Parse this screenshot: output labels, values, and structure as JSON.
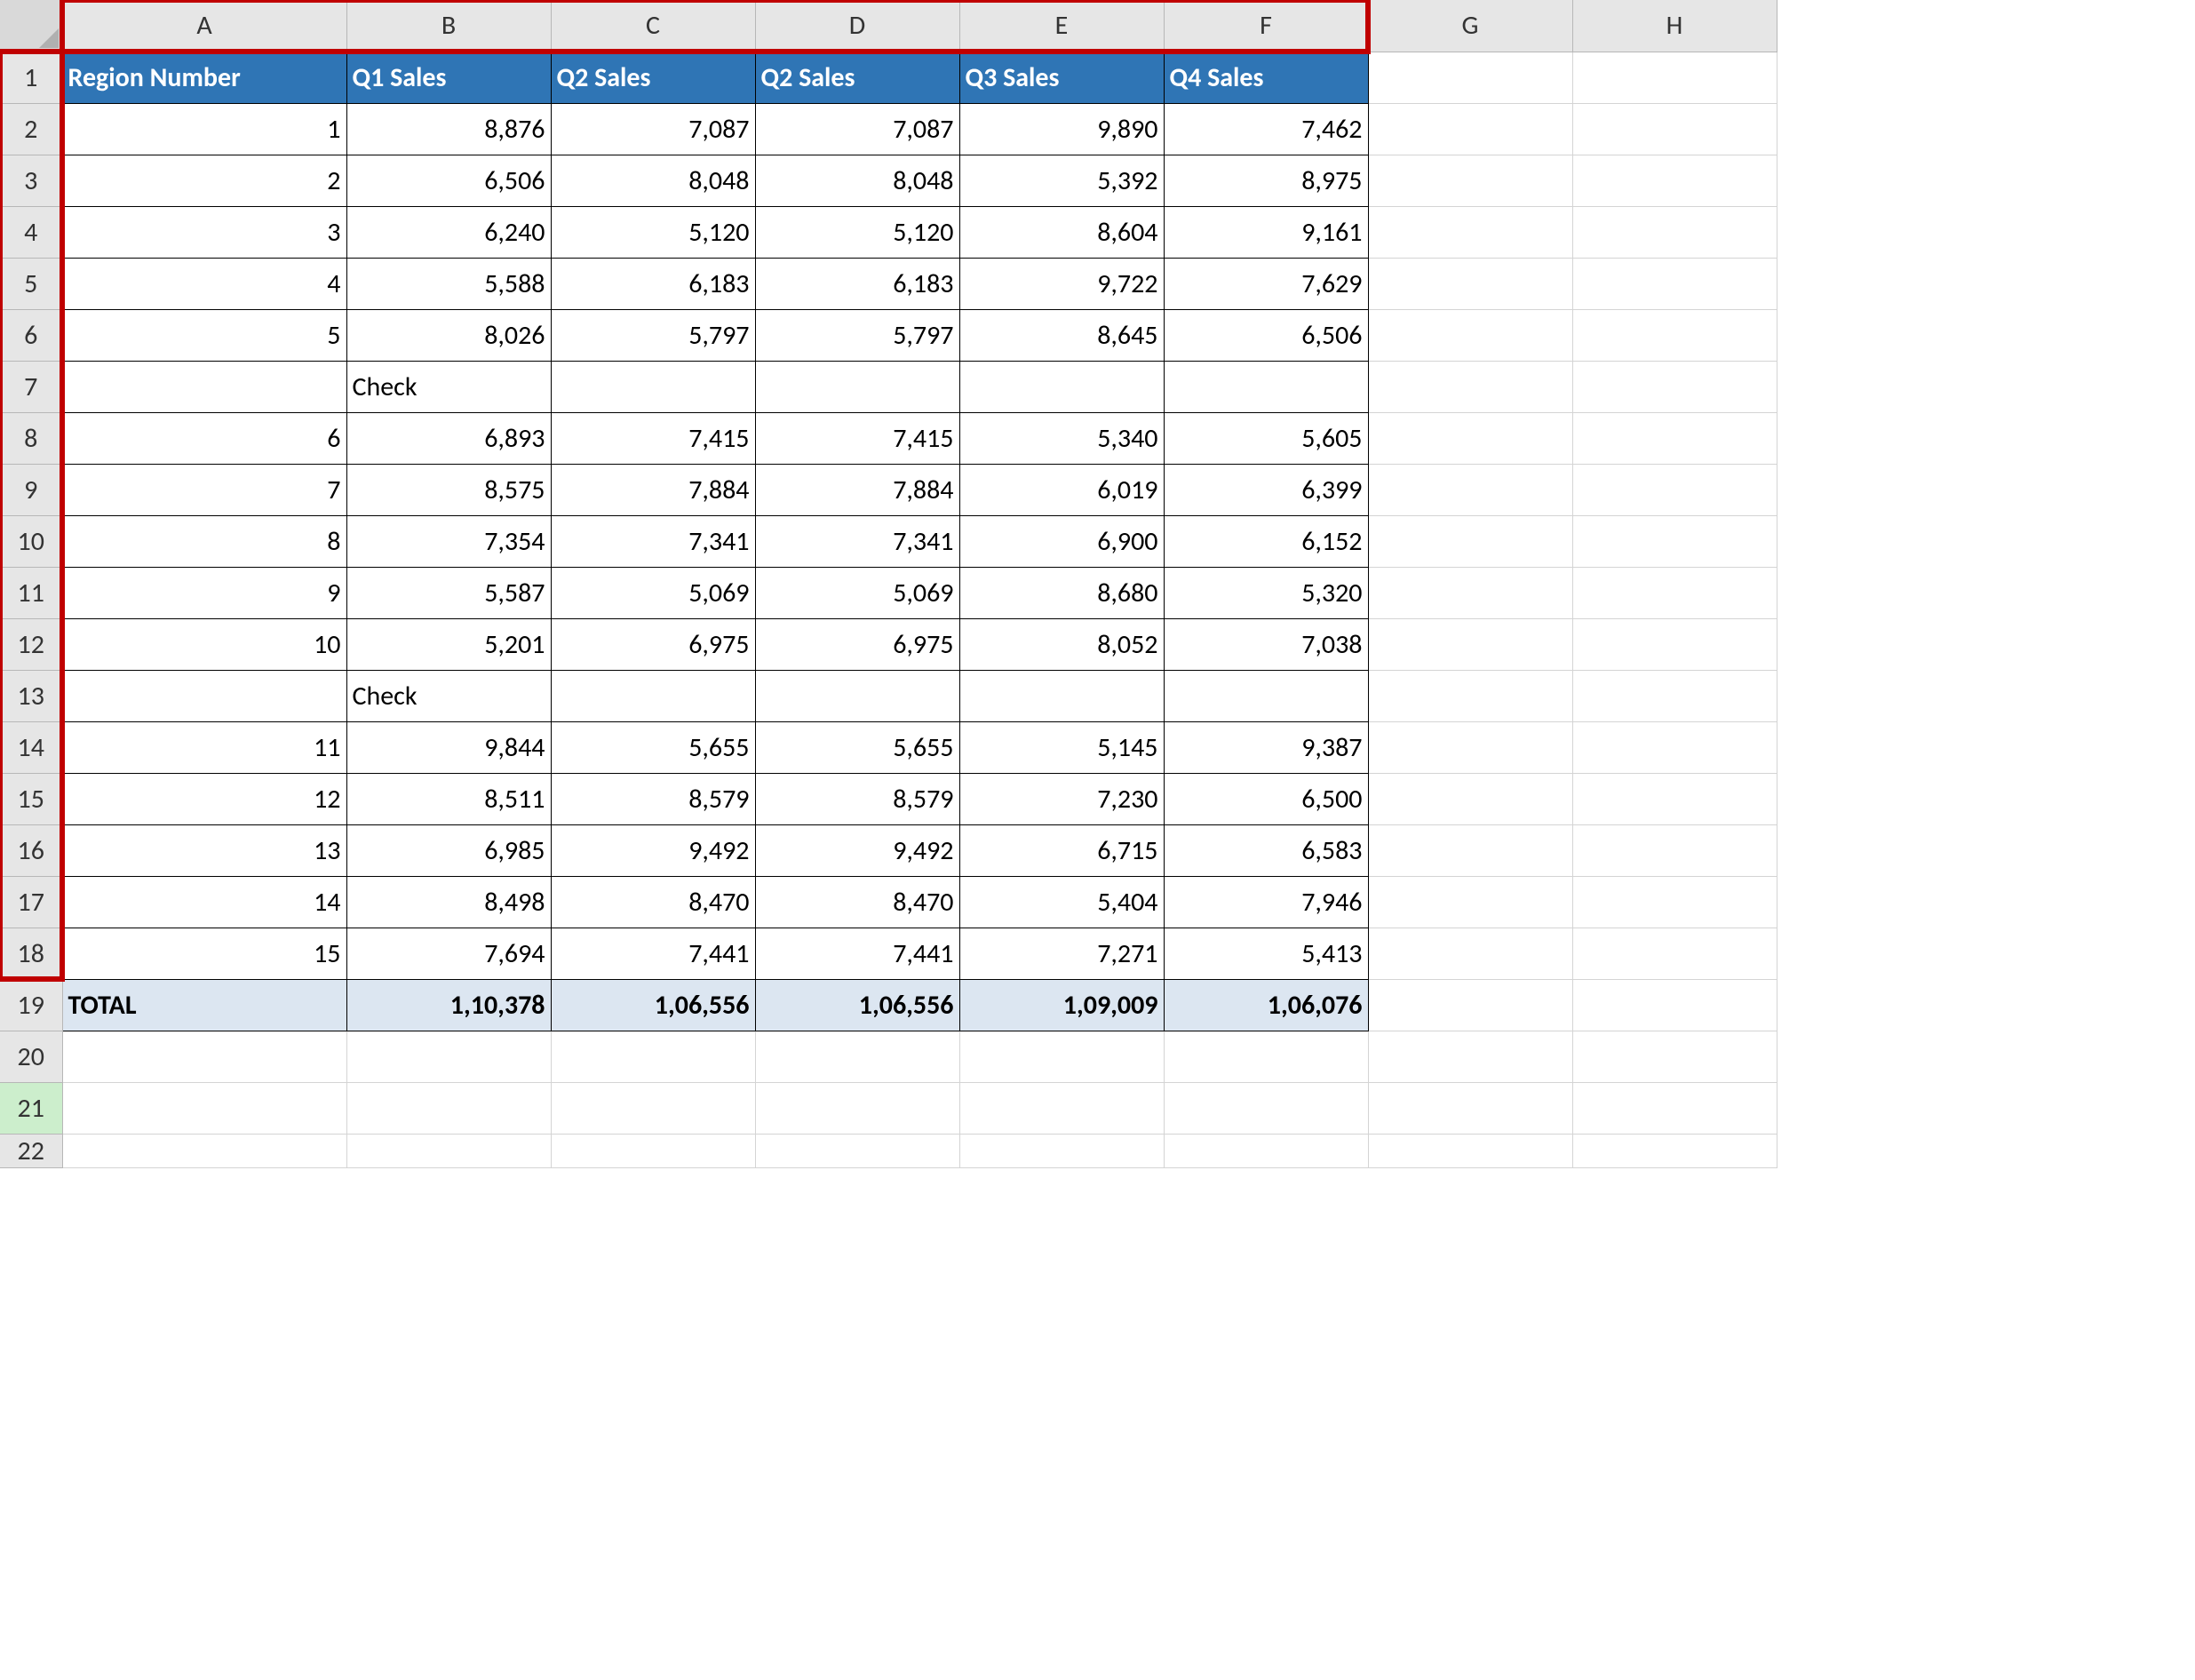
{
  "columns": [
    "A",
    "B",
    "C",
    "D",
    "E",
    "F",
    "G",
    "H"
  ],
  "row_numbers": [
    "1",
    "2",
    "3",
    "4",
    "5",
    "6",
    "7",
    "8",
    "9",
    "10",
    "11",
    "12",
    "13",
    "14",
    "15",
    "16",
    "17",
    "18",
    "19",
    "20",
    "21",
    "22"
  ],
  "headers": {
    "A": "Region Number",
    "B": "Q1 Sales",
    "C": "Q2 Sales",
    "D": "Q2 Sales",
    "E": "Q3 Sales",
    "F": "Q4 Sales"
  },
  "rows": [
    {
      "A": "1",
      "B": "8,876",
      "C": "7,087",
      "D": "7,087",
      "E": "9,890",
      "F": "7,462"
    },
    {
      "A": "2",
      "B": "6,506",
      "C": "8,048",
      "D": "8,048",
      "E": "5,392",
      "F": "8,975"
    },
    {
      "A": "3",
      "B": "6,240",
      "C": "5,120",
      "D": "5,120",
      "E": "8,604",
      "F": "9,161"
    },
    {
      "A": "4",
      "B": "5,588",
      "C": "6,183",
      "D": "6,183",
      "E": "9,722",
      "F": "7,629"
    },
    {
      "A": "5",
      "B": "8,026",
      "C": "5,797",
      "D": "5,797",
      "E": "8,645",
      "F": "6,506"
    },
    {
      "A": "",
      "B": "Check",
      "C": "",
      "D": "",
      "E": "",
      "F": ""
    },
    {
      "A": "6",
      "B": "6,893",
      "C": "7,415",
      "D": "7,415",
      "E": "5,340",
      "F": "5,605"
    },
    {
      "A": "7",
      "B": "8,575",
      "C": "7,884",
      "D": "7,884",
      "E": "6,019",
      "F": "6,399"
    },
    {
      "A": "8",
      "B": "7,354",
      "C": "7,341",
      "D": "7,341",
      "E": "6,900",
      "F": "6,152"
    },
    {
      "A": "9",
      "B": "5,587",
      "C": "5,069",
      "D": "5,069",
      "E": "8,680",
      "F": "5,320"
    },
    {
      "A": "10",
      "B": "5,201",
      "C": "6,975",
      "D": "6,975",
      "E": "8,052",
      "F": "7,038"
    },
    {
      "A": "",
      "B": "Check",
      "C": "",
      "D": "",
      "E": "",
      "F": ""
    },
    {
      "A": "11",
      "B": "9,844",
      "C": "5,655",
      "D": "5,655",
      "E": "5,145",
      "F": "9,387"
    },
    {
      "A": "12",
      "B": "8,511",
      "C": "8,579",
      "D": "8,579",
      "E": "7,230",
      "F": "6,500"
    },
    {
      "A": "13",
      "B": "6,985",
      "C": "9,492",
      "D": "9,492",
      "E": "6,715",
      "F": "6,583"
    },
    {
      "A": "14",
      "B": "8,498",
      "C": "8,470",
      "D": "8,470",
      "E": "5,404",
      "F": "7,946"
    },
    {
      "A": "15",
      "B": "7,694",
      "C": "7,441",
      "D": "7,441",
      "E": "7,271",
      "F": "5,413"
    }
  ],
  "total": {
    "label": "TOTAL",
    "B": "1,10,378",
    "C": "1,06,556",
    "D": "1,06,556",
    "E": "1,09,009",
    "F": "1,06,076"
  },
  "selected_row_header": "21",
  "highlight": {
    "col_range": [
      "A",
      "F"
    ],
    "row_range": [
      "1",
      "18"
    ]
  }
}
